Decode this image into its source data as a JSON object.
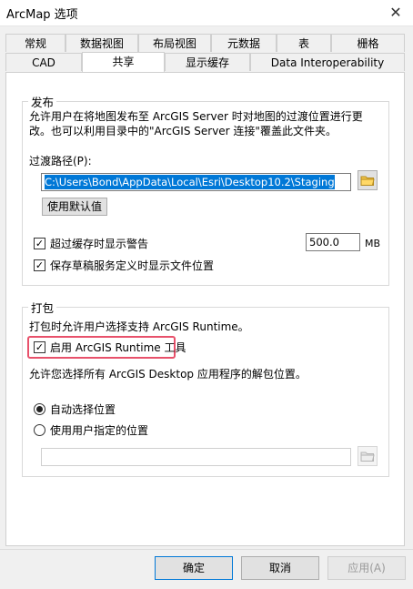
{
  "window": {
    "title": "ArcMap 选项",
    "close_glyph": "✕"
  },
  "tabs_row1": [
    "常规",
    "数据视图",
    "布局视图",
    "元数据",
    "表",
    "栅格"
  ],
  "tabs_row2": [
    "CAD",
    "共享",
    "显示缓存",
    "Data Interoperability"
  ],
  "active_tab": "共享",
  "publish": {
    "legend": "发布",
    "description_line1": "允许用户在将地图发布至 ArcGIS Server 时对地图的过渡位置进行更",
    "description_line2": "改。也可以利用目录中的\"ArcGIS Server 连接\"覆盖此文件夹。",
    "staging_label": "过渡路径(P):",
    "staging_path": "C:\\Users\\Bond\\AppData\\Local\\Esri\\Desktop10.2\\Staging",
    "default_button": "使用默认值",
    "warn_cache_label": "超过缓存时显示警告",
    "warn_cache_checked": true,
    "cache_value": "500.0",
    "cache_unit": "MB",
    "save_draft_label": "保存草稿服务定义时显示文件位置",
    "save_draft_checked": true
  },
  "package": {
    "legend": "打包",
    "description": "打包时允许用户选择支持 ArcGIS Runtime。",
    "enable_runtime_label": "启用 ArcGIS Runtime 工具",
    "enable_runtime_checked": true,
    "unpack_description": "允许您选择所有 ArcGIS Desktop 应用程序的解包位置。",
    "auto_location_label": "自动选择位置",
    "custom_location_label": "使用用户指定的位置",
    "selected_option": "auto",
    "custom_path": ""
  },
  "footer": {
    "ok": "确定",
    "cancel": "取消",
    "apply": "应用(A)"
  },
  "colors": {
    "highlight": "#e8516b",
    "selection": "#0078d7"
  }
}
